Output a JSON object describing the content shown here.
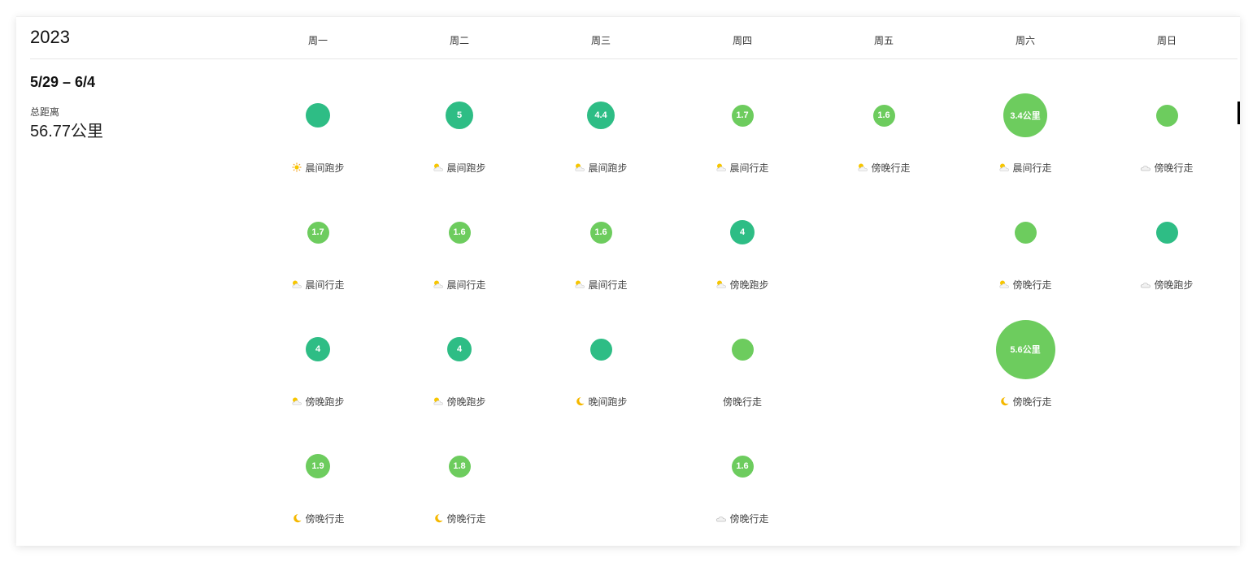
{
  "year": "2023",
  "days": [
    "周一",
    "周二",
    "周三",
    "周四",
    "周五",
    "周六",
    "周日"
  ],
  "week": {
    "range": "5/29 – 6/4",
    "total_label": "总距离",
    "total_value": "56.77公里"
  },
  "colors": {
    "run": "#2ebd85",
    "walk": "#6dcc5e",
    "brand": "#2ebd85"
  },
  "activities": [
    {
      "day": 0,
      "row": 0,
      "distance": 2.2,
      "label": "",
      "type": "run",
      "icon": "sun-icon",
      "name": "晨间跑步"
    },
    {
      "day": 1,
      "row": 0,
      "distance": 5,
      "label": "5",
      "type": "run",
      "icon": "sun-cloud-icon",
      "name": "晨间跑步"
    },
    {
      "day": 2,
      "row": 0,
      "distance": 4.4,
      "label": "4.4",
      "type": "run",
      "icon": "sun-cloud-icon",
      "name": "晨间跑步"
    },
    {
      "day": 3,
      "row": 0,
      "distance": 1.7,
      "label": "1.7",
      "type": "walk",
      "icon": "sun-cloud-icon",
      "name": "晨间行走"
    },
    {
      "day": 4,
      "row": 0,
      "distance": 1.6,
      "label": "1.6",
      "type": "walk",
      "icon": "sun-cloud-icon",
      "name": "傍晚行走"
    },
    {
      "day": 5,
      "row": 0,
      "distance": 3.4,
      "label": "3.4公里",
      "type": "walk",
      "icon": "sun-cloud-icon",
      "name": "晨间行走"
    },
    {
      "day": 6,
      "row": 0,
      "distance": 1.6,
      "label": "",
      "type": "walk",
      "icon": "cloud-icon",
      "name": "傍晚行走"
    },
    {
      "day": 0,
      "row": 1,
      "distance": 1.7,
      "label": "1.7",
      "type": "walk",
      "icon": "sun-cloud-icon",
      "name": "晨间行走"
    },
    {
      "day": 1,
      "row": 1,
      "distance": 1.6,
      "label": "1.6",
      "type": "walk",
      "icon": "sun-cloud-icon",
      "name": "晨间行走"
    },
    {
      "day": 2,
      "row": 1,
      "distance": 1.6,
      "label": "1.6",
      "type": "walk",
      "icon": "sun-cloud-icon",
      "name": "晨间行走"
    },
    {
      "day": 3,
      "row": 1,
      "distance": 4,
      "label": "4",
      "type": "run",
      "icon": "sun-cloud-icon",
      "name": "傍晚跑步"
    },
    {
      "day": 5,
      "row": 1,
      "distance": 1.6,
      "label": "",
      "type": "walk",
      "icon": "sun-cloud-icon",
      "name": "傍晚行走"
    },
    {
      "day": 6,
      "row": 1,
      "distance": 1.6,
      "label": "",
      "type": "run",
      "icon": "cloud-icon",
      "name": "傍晚跑步"
    },
    {
      "day": 0,
      "row": 2,
      "distance": 4,
      "label": "4",
      "type": "run",
      "icon": "sun-cloud-icon",
      "name": "傍晚跑步"
    },
    {
      "day": 1,
      "row": 2,
      "distance": 4,
      "label": "4",
      "type": "run",
      "icon": "sun-cloud-icon",
      "name": "傍晚跑步"
    },
    {
      "day": 2,
      "row": 2,
      "distance": 1.6,
      "label": "",
      "type": "run",
      "icon": "moon-icon",
      "name": "晚间跑步"
    },
    {
      "day": 3,
      "row": 2,
      "distance": 1.6,
      "label": "",
      "type": "walk",
      "icon": "",
      "name": "傍晚行走"
    },
    {
      "day": 5,
      "row": 2,
      "distance": 5.6,
      "label": "5.6公里",
      "type": "walk",
      "icon": "moon-icon",
      "name": "傍晚行走"
    },
    {
      "day": 0,
      "row": 3,
      "distance": 1.9,
      "label": "1.9",
      "type": "walk",
      "icon": "moon-icon",
      "name": "傍晚行走"
    },
    {
      "day": 1,
      "row": 3,
      "distance": 1.8,
      "label": "1.8",
      "type": "walk",
      "icon": "moon-icon",
      "name": "傍晚行走"
    },
    {
      "day": 3,
      "row": 3,
      "distance": 1.6,
      "label": "1.6",
      "type": "walk",
      "icon": "cloud-icon",
      "name": "傍晚行走"
    }
  ]
}
